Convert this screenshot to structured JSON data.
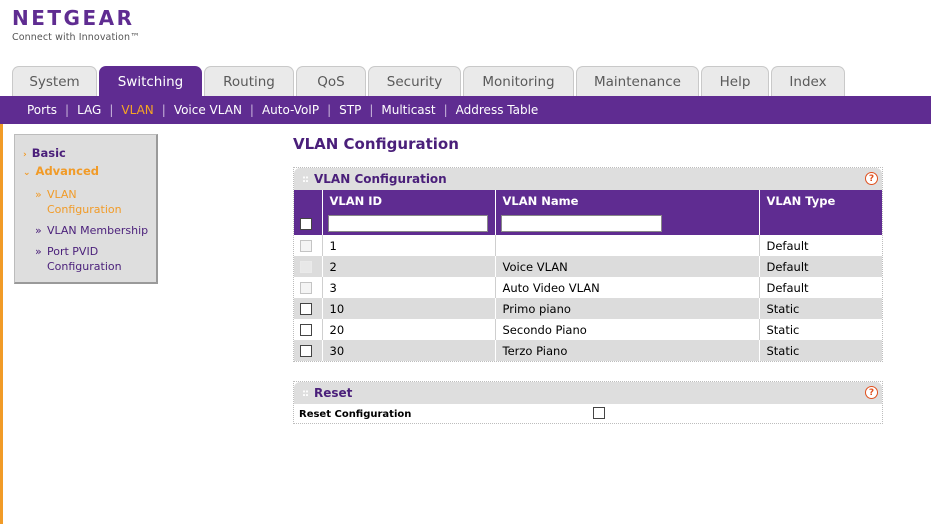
{
  "brand": {
    "name": "NETGEAR",
    "tagline": "Connect with Innovation™",
    "color_primary": "#5f2c91",
    "color_accent": "#f19b28"
  },
  "tabs": [
    {
      "label": "System",
      "active": false
    },
    {
      "label": "Switching",
      "active": true
    },
    {
      "label": "Routing",
      "active": false
    },
    {
      "label": "QoS",
      "active": false
    },
    {
      "label": "Security",
      "active": false
    },
    {
      "label": "Monitoring",
      "active": false
    },
    {
      "label": "Maintenance",
      "active": false
    },
    {
      "label": "Help",
      "active": false
    },
    {
      "label": "Index",
      "active": false
    }
  ],
  "subnav": [
    {
      "label": "Ports",
      "active": false
    },
    {
      "label": "LAG",
      "active": false
    },
    {
      "label": "VLAN",
      "active": true
    },
    {
      "label": "Voice VLAN",
      "active": false
    },
    {
      "label": "Auto-VoIP",
      "active": false
    },
    {
      "label": "STP",
      "active": false
    },
    {
      "label": "Multicast",
      "active": false
    },
    {
      "label": "Address Table",
      "active": false
    }
  ],
  "leftmenu": {
    "basic": "Basic",
    "advanced": "Advanced",
    "items": [
      {
        "bullet": "»",
        "label": "VLAN Configuration",
        "active": true
      },
      {
        "bullet": "»",
        "label": "VLAN Membership",
        "active": false
      },
      {
        "bullet": "»",
        "label": "Port PVID Configuration",
        "active": false
      }
    ]
  },
  "page": {
    "title": "VLAN Configuration"
  },
  "vlan_panel": {
    "title": "VLAN Configuration",
    "help": "?",
    "headers": [
      "",
      "VLAN ID",
      "VLAN Name",
      "VLAN Type"
    ],
    "input_id_value": "",
    "input_name_value": "",
    "rows": [
      {
        "id": "1",
        "name": "",
        "type": "Default",
        "selectable": false
      },
      {
        "id": "2",
        "name": "Voice VLAN",
        "type": "Default",
        "selectable": false
      },
      {
        "id": "3",
        "name": "Auto Video VLAN",
        "type": "Default",
        "selectable": false
      },
      {
        "id": "10",
        "name": "Primo piano",
        "type": "Static",
        "selectable": true
      },
      {
        "id": "20",
        "name": "Secondo Piano",
        "type": "Static",
        "selectable": true
      },
      {
        "id": "30",
        "name": "Terzo Piano",
        "type": "Static",
        "selectable": true
      }
    ]
  },
  "reset_panel": {
    "title": "Reset",
    "help": "?",
    "label": "Reset Configuration",
    "checked": false
  }
}
